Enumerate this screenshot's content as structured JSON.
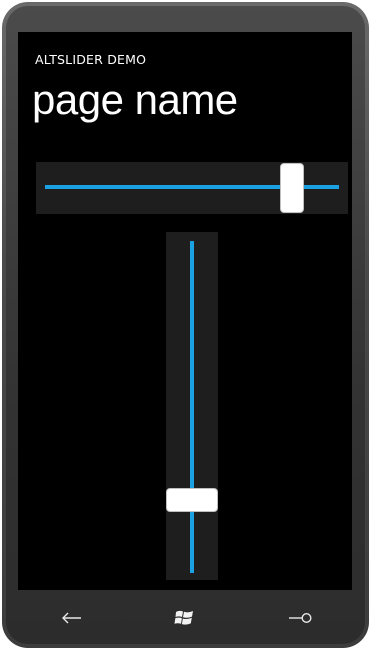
{
  "app": {
    "title": "ALTSLIDER DEMO",
    "page_name": "page name"
  },
  "horizontal_slider": {
    "orientation": "horizontal",
    "value_fraction": 0.84,
    "track_color": "#1ba1e2",
    "thumb_color": "#ffffff",
    "background_color": "#1e1e1e"
  },
  "vertical_slider": {
    "orientation": "vertical",
    "value_fraction": 0.22,
    "track_color": "#1ba1e2",
    "thumb_color": "#ffffff",
    "background_color": "#1e1e1e"
  },
  "hardware_buttons": [
    {
      "name": "back",
      "icon": "back-arrow-icon"
    },
    {
      "name": "start",
      "icon": "windows-logo-icon"
    },
    {
      "name": "search",
      "icon": "search-icon"
    }
  ]
}
